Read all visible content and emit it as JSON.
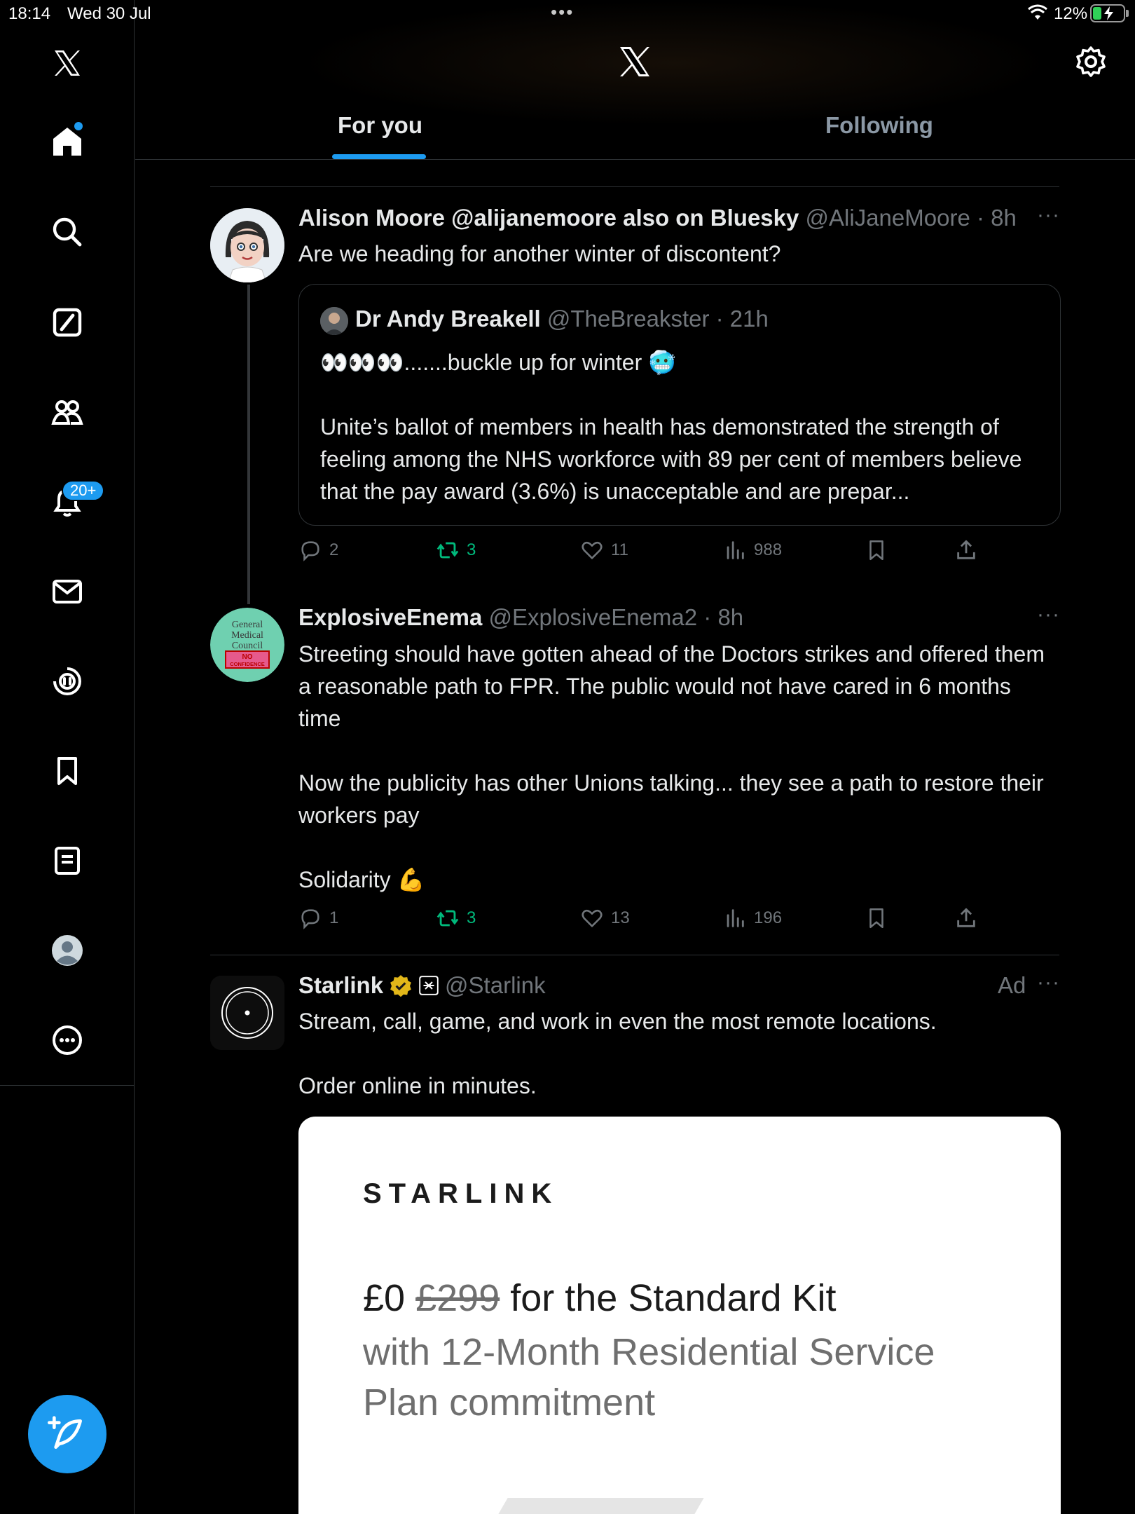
{
  "status_bar": {
    "time": "18:14",
    "date": "Wed 30 Jul",
    "dots": "•••",
    "battery": "12%"
  },
  "sidebar": {
    "notifications_badge": "20+",
    "items": [
      "X",
      "Home",
      "Explore",
      "Grok",
      "Communities",
      "Notifications",
      "Messages",
      "Spaces",
      "Bookmarks",
      "Lists",
      "Profile",
      "More"
    ]
  },
  "header": {
    "tabs": [
      {
        "label": "For you"
      },
      {
        "label": "Following"
      }
    ]
  },
  "tweets": [
    {
      "name": "Alison Moore @alijanemoore also on Bluesky",
      "meta": "@AliJaneMoore · 8h",
      "text": "Are we heading for another winter of discontent?",
      "quote": {
        "name": "Dr Andy Breakell",
        "meta": "@TheBreakster · 21h",
        "line1": "👀👀👀.......buckle up for winter 🥶",
        "body": "Unite’s ballot of members in health has demonstrated the strength of feeling among the NHS workforce with 89 per cent of members believe that the pay award (3.6%) is unacceptable and are prepar..."
      },
      "stats": {
        "replies": "2",
        "reposts": "3",
        "likes": "11",
        "views": "988"
      }
    },
    {
      "name": "ExplosiveEnema",
      "meta": "@ExplosiveEnema2 · 8h",
      "avatar_text": [
        "General",
        "Medical",
        "Council",
        "NO",
        "CONFIDENCE"
      ],
      "text_p1": "Streeting should have gotten ahead of the Doctors strikes and offered them a reasonable path to FPR. The public would not have cared in 6 months time",
      "text_p2": "Now the publicity has other Unions talking... they see a path to restore their workers pay",
      "text_p3": "Solidarity 💪",
      "stats": {
        "replies": "1",
        "reposts": "3",
        "likes": "13",
        "views": "196"
      }
    },
    {
      "name": "Starlink",
      "meta": "@Starlink",
      "ad_label": "Ad",
      "text_p1": "Stream, call, game, and work in even the most remote locations.",
      "text_p2": "Order online in minutes.",
      "card": {
        "brand": "STARLINK",
        "price_now": "£0",
        "price_was": "£299",
        "headline_rest": "for the Standard Kit",
        "sub": "with 12-Month Residential Service Plan commitment"
      }
    }
  ],
  "colors": {
    "accent": "#1d9bf0",
    "repost_green": "#00ba7c",
    "verified_gold": "#e2b719"
  }
}
